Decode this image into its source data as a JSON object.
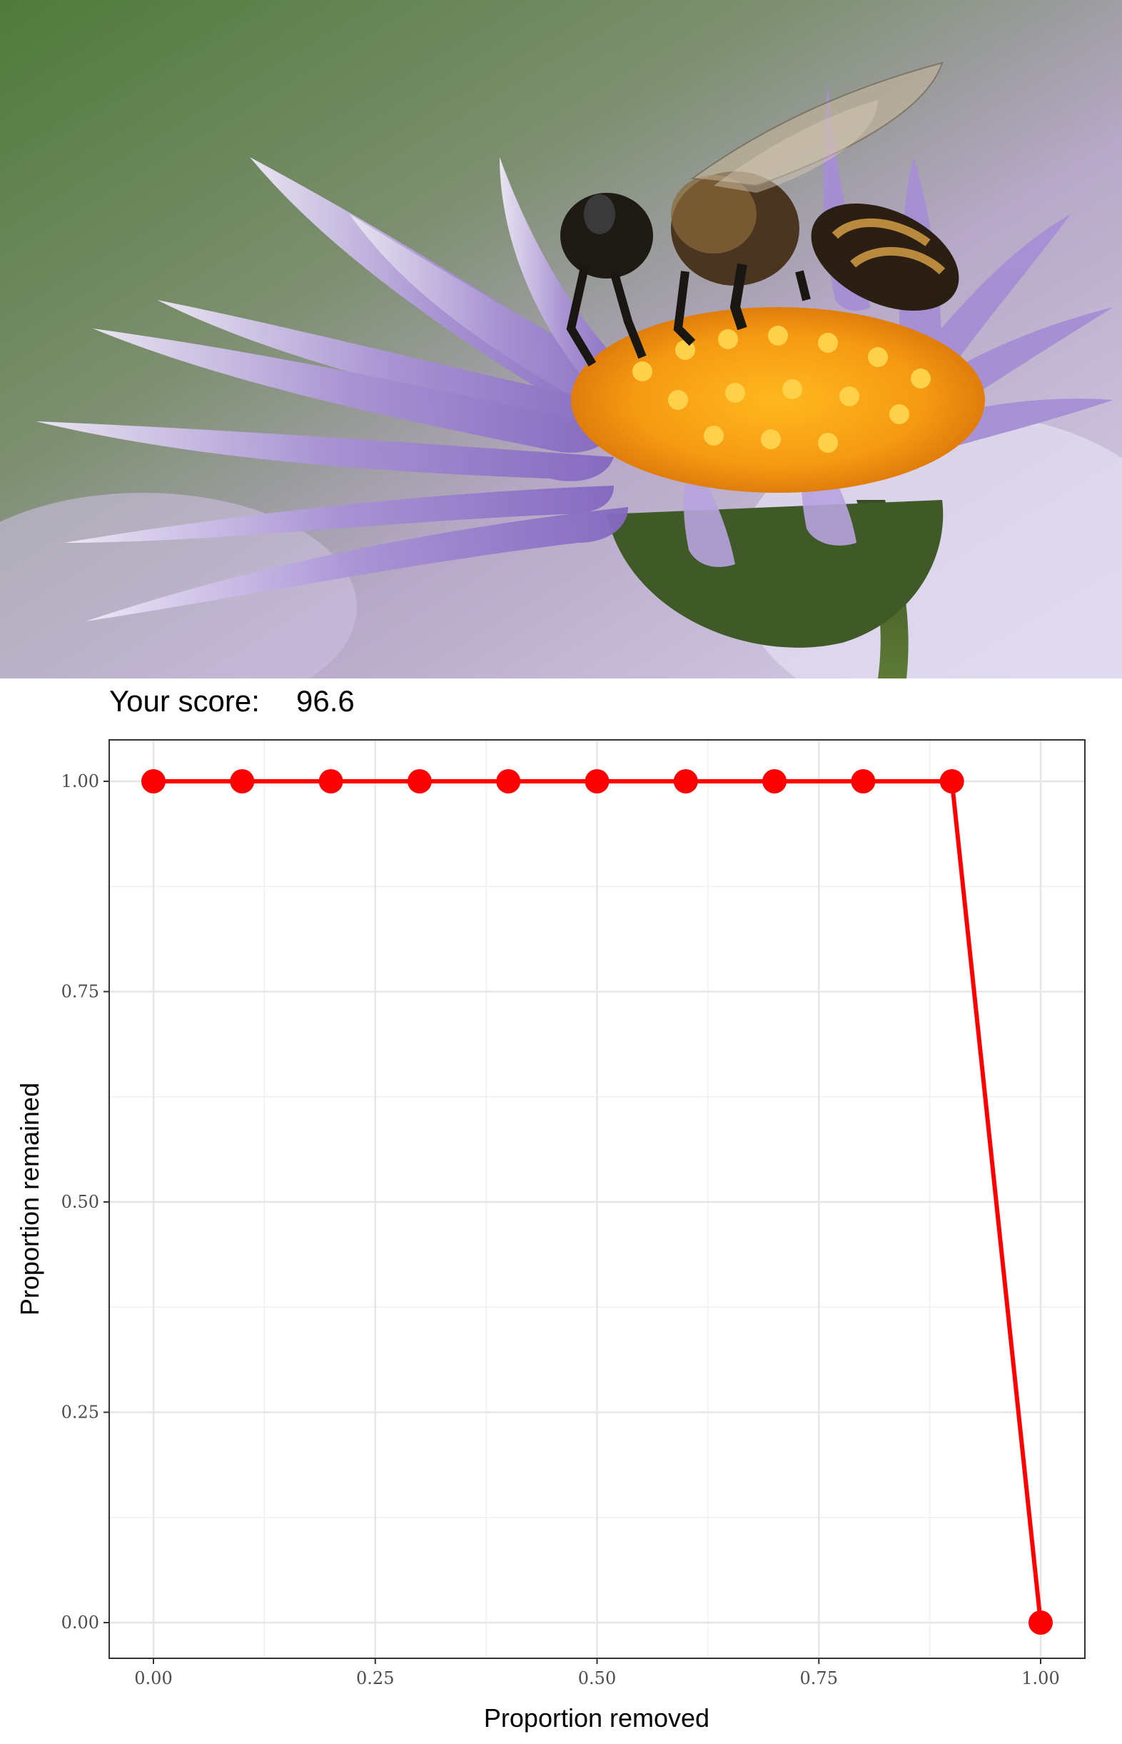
{
  "figure": {
    "image_description_icon": "bee-on-aster-photo",
    "score_label": "Your score:",
    "score_value": "96.6"
  },
  "chart_data": {
    "type": "line",
    "title": "",
    "xlabel": "Proportion removed",
    "ylabel": "Proportion remained",
    "xlim": [
      0,
      1
    ],
    "ylim": [
      0,
      1
    ],
    "x_ticks": [
      "0.00",
      "0.25",
      "0.50",
      "0.75",
      "1.00"
    ],
    "y_ticks": [
      "0.00",
      "0.25",
      "0.50",
      "0.75",
      "1.00"
    ],
    "grid": true,
    "legend": "none",
    "series": [
      {
        "x": [
          0.0,
          0.1,
          0.2,
          0.3,
          0.4,
          0.5,
          0.6,
          0.7,
          0.8,
          0.9,
          1.0
        ],
        "y": [
          1,
          1,
          1,
          1,
          1,
          1,
          1,
          1,
          1,
          1,
          0
        ],
        "color": "#ff0000"
      }
    ]
  }
}
